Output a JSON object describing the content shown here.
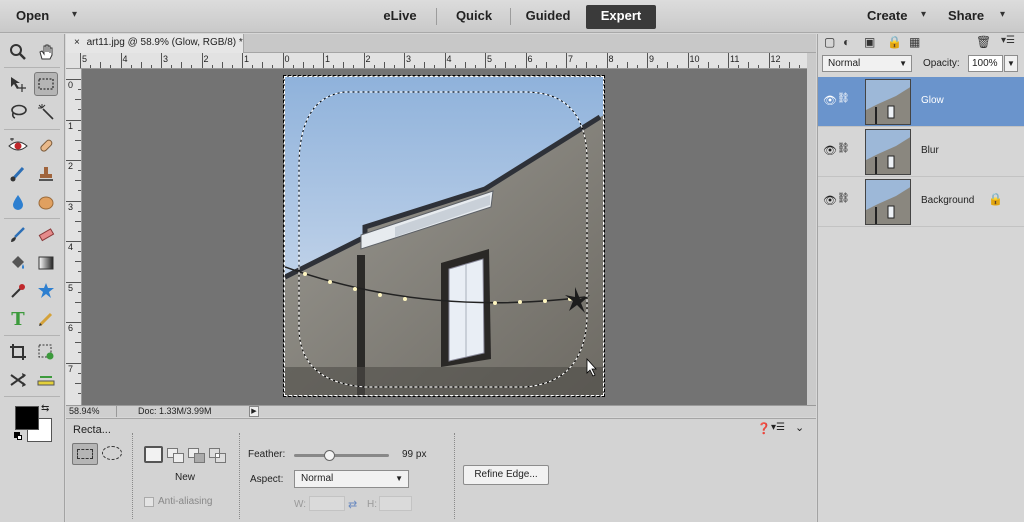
{
  "topbar": {
    "open_label": "Open",
    "modes": [
      "eLive",
      "Quick",
      "Guided",
      "Expert"
    ],
    "active_mode": "Expert",
    "create_label": "Create",
    "share_label": "Share"
  },
  "document": {
    "tab_title": "art11.jpg @ 58.9% (Glow, RGB/8) *",
    "close_glyph": "×",
    "zoom_status": "58.94%",
    "doc_status": "Doc: 1.33M/3.99M"
  },
  "rulers": {
    "horizontal_labels": [
      "5",
      "4",
      "3",
      "2",
      "1",
      "0",
      "1",
      "2",
      "3",
      "4",
      "5",
      "6",
      "7",
      "8",
      "9",
      "10",
      "11",
      "12"
    ],
    "vertical_labels": [
      "0",
      "1",
      "2",
      "3",
      "4",
      "5",
      "6",
      "7"
    ]
  },
  "tools": [
    {
      "name": "zoom-icon",
      "glyph": "🔍"
    },
    {
      "name": "hand-icon",
      "glyph": "✋"
    },
    {
      "name": "move-icon",
      "glyph": "✥"
    },
    {
      "name": "rectangular-marquee-icon",
      "glyph": "⬚"
    },
    {
      "name": "lasso-icon",
      "glyph": "ↄ"
    },
    {
      "name": "quick-selection-icon",
      "glyph": "✎"
    },
    {
      "name": "red-eye-icon",
      "glyph": "👁"
    },
    {
      "name": "spot-healing-icon",
      "glyph": "✚"
    },
    {
      "name": "smart-brush-icon",
      "glyph": "🖌"
    },
    {
      "name": "clone-stamp-icon",
      "glyph": "⛳"
    },
    {
      "name": "blur-icon",
      "glyph": "💧"
    },
    {
      "name": "sponge-icon",
      "glyph": "●"
    },
    {
      "name": "brush-icon",
      "glyph": "🖌"
    },
    {
      "name": "eraser-icon",
      "glyph": "▭"
    },
    {
      "name": "paint-bucket-icon",
      "glyph": "🪣"
    },
    {
      "name": "gradient-icon",
      "glyph": "▦"
    },
    {
      "name": "eyedropper-icon",
      "glyph": "✒"
    },
    {
      "name": "custom-shape-icon",
      "glyph": "✱"
    },
    {
      "name": "type-icon",
      "glyph": "T"
    },
    {
      "name": "pencil-icon",
      "glyph": "✏"
    },
    {
      "name": "crop-icon",
      "glyph": "⌗"
    },
    {
      "name": "recompose-icon",
      "glyph": "⚙"
    },
    {
      "name": "content-aware-move-icon",
      "glyph": "⤨"
    },
    {
      "name": "straighten-icon",
      "glyph": "▬"
    }
  ],
  "colors": {
    "foreground": "#000000",
    "background": "#ffffff",
    "selected_layer": "#6a94cc",
    "canvas_bg": "#737373"
  },
  "options": {
    "tool_name": "Recta...",
    "new_label": "New",
    "anti_alias_label": "Anti-aliasing",
    "feather_label": "Feather:",
    "feather_value": "99 px",
    "feather_fraction": 0.37,
    "aspect_label": "Aspect:",
    "aspect_value": "Normal",
    "w_label": "W:",
    "h_label": "H:",
    "refine_edge_label": "Refine Edge..."
  },
  "layers_panel": {
    "blend_mode": "Normal",
    "opacity_label": "Opacity:",
    "opacity_value": "100%",
    "layers": [
      {
        "name": "Glow",
        "selected": true,
        "locked": false
      },
      {
        "name": "Blur",
        "selected": false,
        "locked": false
      },
      {
        "name": "Background",
        "selected": false,
        "locked": true
      }
    ]
  }
}
